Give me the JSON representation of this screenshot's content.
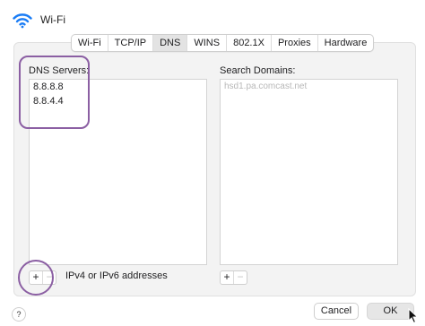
{
  "window": {
    "title": "Wi-Fi",
    "icon": "wifi-icon",
    "accent_color": "#1a7cf5"
  },
  "tabs": [
    {
      "label": "Wi-Fi",
      "active": false
    },
    {
      "label": "TCP/IP",
      "active": false
    },
    {
      "label": "DNS",
      "active": true
    },
    {
      "label": "WINS",
      "active": false
    },
    {
      "label": "802.1X",
      "active": false
    },
    {
      "label": "Proxies",
      "active": false
    },
    {
      "label": "Hardware",
      "active": false
    }
  ],
  "dns": {
    "label": "DNS Servers:",
    "servers": [
      "8.8.8.8",
      "8.8.4.4"
    ],
    "add_label": "+",
    "remove_label": "−",
    "hint": "IPv4 or IPv6 addresses"
  },
  "search_domains": {
    "label": "Search Domains:",
    "placeholder": "hsd1.pa.comcast.net",
    "add_label": "+",
    "remove_label": "−"
  },
  "footer": {
    "help_label": "?",
    "cancel_label": "Cancel",
    "ok_label": "OK"
  },
  "annotation_color": "#8b5fa3"
}
